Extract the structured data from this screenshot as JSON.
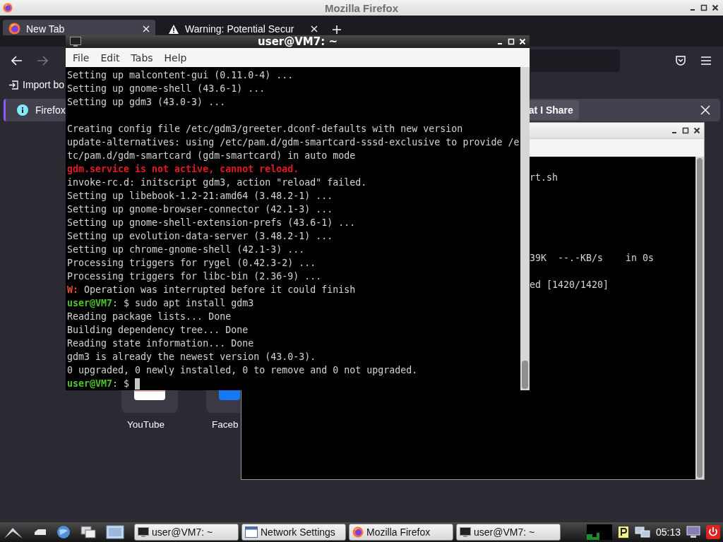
{
  "firefox": {
    "title": "Mozilla Firefox",
    "tabs": [
      {
        "label": "New Tab",
        "selected": true
      },
      {
        "label": "Warning: Potential Secur",
        "selected": false
      }
    ],
    "bookmarks": [
      {
        "label": "Import bo"
      }
    ],
    "notification": {
      "text": "Firefox",
      "button": "at I Share"
    },
    "shortcuts": [
      {
        "label": "YouTube"
      },
      {
        "label": "Faceb"
      }
    ]
  },
  "background_terminal": {
    "lines": [
      {
        "kind": "blank"
      },
      {
        "kind": "text",
        "parts": [
          {
            "text": "rt.sh",
            "kind": "plain"
          }
        ]
      },
      {
        "kind": "blank"
      },
      {
        "kind": "blank"
      },
      {
        "kind": "blank"
      },
      {
        "kind": "blank"
      },
      {
        "kind": "blank"
      },
      {
        "kind": "text",
        "parts": [
          {
            "text": "39K  --.-KB/s    in 0s",
            "kind": "plain"
          }
        ]
      },
      {
        "kind": "blank"
      },
      {
        "kind": "text",
        "parts": [
          {
            "text": "ed [1420/1420]",
            "kind": "plain"
          }
        ]
      }
    ]
  },
  "terminal": {
    "title": "user@VM7: ~",
    "menu": [
      "File",
      "Edit",
      "Tabs",
      "Help"
    ],
    "lines": [
      {
        "kind": "text",
        "parts": [
          {
            "text": "Setting up malcontent-gui (0.11.0-4) ...",
            "kind": "plain"
          }
        ]
      },
      {
        "kind": "text",
        "parts": [
          {
            "text": "Setting up gnome-shell (43.6-1) ...",
            "kind": "plain"
          }
        ]
      },
      {
        "kind": "text",
        "parts": [
          {
            "text": "Setting up gdm3 (43.0-3) ...",
            "kind": "plain"
          }
        ]
      },
      {
        "kind": "blank"
      },
      {
        "kind": "text",
        "parts": [
          {
            "text": "Creating config file /etc/gdm3/greeter.dconf-defaults with new version",
            "kind": "plain"
          }
        ]
      },
      {
        "kind": "text",
        "parts": [
          {
            "text": "update-alternatives: using /etc/pam.d/gdm-smartcard-sssd-exclusive to provide /e",
            "kind": "plain"
          }
        ]
      },
      {
        "kind": "text",
        "parts": [
          {
            "text": "tc/pam.d/gdm-smartcard (gdm-smartcard) in auto mode",
            "kind": "plain"
          }
        ]
      },
      {
        "kind": "text",
        "parts": [
          {
            "text": "gdm.service is not active, cannot reload.",
            "kind": "error"
          }
        ]
      },
      {
        "kind": "text",
        "parts": [
          {
            "text": "invoke-rc.d: initscript gdm3, action \"reload\" failed.",
            "kind": "plain"
          }
        ]
      },
      {
        "kind": "text",
        "parts": [
          {
            "text": "Setting up libebook-1.2-21:amd64 (3.48.2-1) ...",
            "kind": "plain"
          }
        ]
      },
      {
        "kind": "text",
        "parts": [
          {
            "text": "Setting up gnome-browser-connector (42.1-3) ...",
            "kind": "plain"
          }
        ]
      },
      {
        "kind": "text",
        "parts": [
          {
            "text": "Setting up gnome-shell-extension-prefs (43.6-1) ...",
            "kind": "plain"
          }
        ]
      },
      {
        "kind": "text",
        "parts": [
          {
            "text": "Setting up evolution-data-server (3.48.2-1) ...",
            "kind": "plain"
          }
        ]
      },
      {
        "kind": "text",
        "parts": [
          {
            "text": "Setting up chrome-gnome-shell (42.1-3) ...",
            "kind": "plain"
          }
        ]
      },
      {
        "kind": "text",
        "parts": [
          {
            "text": "Processing triggers for rygel (0.42.3-2) ...",
            "kind": "plain"
          }
        ]
      },
      {
        "kind": "text",
        "parts": [
          {
            "text": "Processing triggers for libc-bin (2.36-9) ...",
            "kind": "plain"
          }
        ]
      },
      {
        "kind": "text",
        "parts": [
          {
            "text": "W:",
            "kind": "warning"
          },
          {
            "text": " Operation was interrupted before it could finish",
            "kind": "plain"
          }
        ]
      },
      {
        "kind": "text",
        "parts": [
          {
            "text": "user@VM7",
            "kind": "prompt"
          },
          {
            "text": ": $ sudo apt install gdm3",
            "kind": "plain"
          }
        ]
      },
      {
        "kind": "text",
        "parts": [
          {
            "text": "Reading package lists... Done",
            "kind": "plain"
          }
        ]
      },
      {
        "kind": "text",
        "parts": [
          {
            "text": "Building dependency tree... Done",
            "kind": "plain"
          }
        ]
      },
      {
        "kind": "text",
        "parts": [
          {
            "text": "Reading state information... Done",
            "kind": "plain"
          }
        ]
      },
      {
        "kind": "text",
        "parts": [
          {
            "text": "gdm3 is already the newest version (43.0-3).",
            "kind": "plain"
          }
        ]
      },
      {
        "kind": "text",
        "parts": [
          {
            "text": "0 upgraded, 0 newly installed, 0 to remove and 0 not upgraded.",
            "kind": "plain"
          }
        ]
      },
      {
        "kind": "prompt",
        "parts": [
          {
            "text": "user@VM7",
            "kind": "prompt"
          },
          {
            "text": ": $ ",
            "kind": "plain"
          }
        ]
      }
    ]
  },
  "taskbar": {
    "tasks": [
      {
        "label": "user@VM7: ~",
        "kind": "terminal"
      },
      {
        "label": "Network Settings",
        "kind": "settings"
      },
      {
        "label": "Mozilla Firefox",
        "kind": "browser"
      },
      {
        "label": "user@VM7: ~",
        "kind": "terminal"
      }
    ],
    "clock": "05:13"
  }
}
